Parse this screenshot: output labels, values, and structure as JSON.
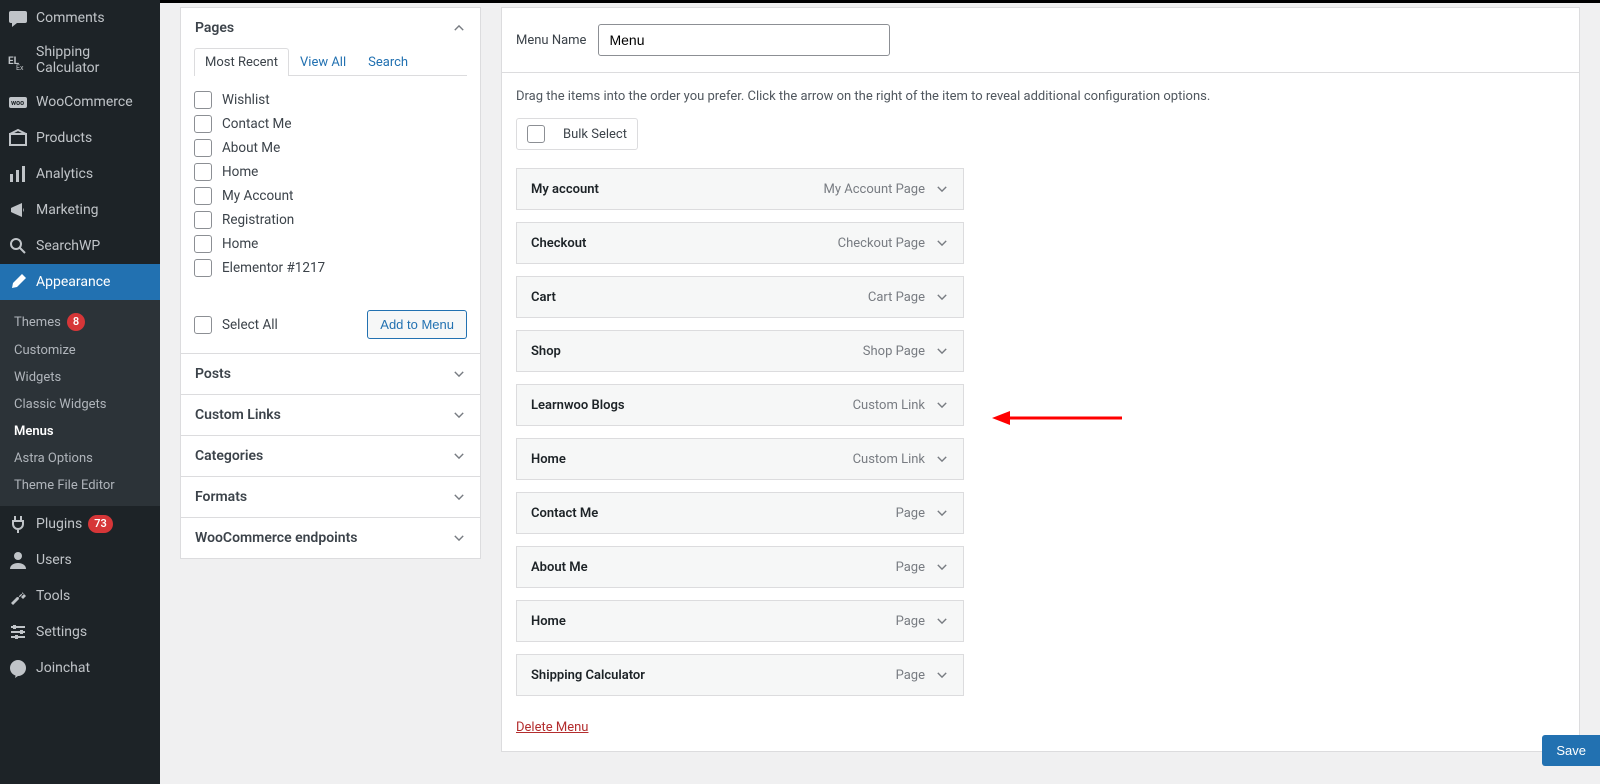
{
  "sidebar": {
    "items": [
      {
        "id": "comments",
        "label": "Comments",
        "icon": "comment"
      },
      {
        "id": "shipcalc",
        "label": "Shipping Calculator",
        "icon": "elex"
      },
      {
        "id": "woocommerce",
        "label": "WooCommerce",
        "icon": "woo"
      },
      {
        "id": "products",
        "label": "Products",
        "icon": "box"
      },
      {
        "id": "analytics",
        "label": "Analytics",
        "icon": "chart"
      },
      {
        "id": "marketing",
        "label": "Marketing",
        "icon": "megaphone"
      },
      {
        "id": "searchwp",
        "label": "SearchWP",
        "icon": "search"
      },
      {
        "id": "appearance",
        "label": "Appearance",
        "icon": "brush",
        "current": true
      },
      {
        "id": "plugins",
        "label": "Plugins",
        "icon": "plug",
        "badge": "73"
      },
      {
        "id": "users",
        "label": "Users",
        "icon": "user"
      },
      {
        "id": "tools",
        "label": "Tools",
        "icon": "wrench"
      },
      {
        "id": "settings",
        "label": "Settings",
        "icon": "sliders"
      },
      {
        "id": "joinchat",
        "label": "Joinchat",
        "icon": "chat"
      }
    ],
    "submenu": [
      {
        "label": "Themes",
        "badge": "8"
      },
      {
        "label": "Customize"
      },
      {
        "label": "Widgets"
      },
      {
        "label": "Classic Widgets"
      },
      {
        "label": "Menus",
        "current": true
      },
      {
        "label": "Astra Options"
      },
      {
        "label": "Theme File Editor"
      }
    ]
  },
  "pages_panel": {
    "title": "Pages",
    "tabs": [
      "Most Recent",
      "View All",
      "Search"
    ],
    "active_tab": 0,
    "items": [
      "Wishlist",
      "Contact Me",
      "About Me",
      "Home",
      "My Account",
      "Registration",
      "Home",
      "Elementor #1217"
    ],
    "select_all": "Select All",
    "add_button": "Add to Menu"
  },
  "other_panels": [
    "Posts",
    "Custom Links",
    "Categories",
    "Formats",
    "WooCommerce endpoints"
  ],
  "editor": {
    "name_label": "Menu Name",
    "name_value": "Menu",
    "help": "Drag the items into the order you prefer. Click the arrow on the right of the item to reveal additional configuration options.",
    "bulk_label": "Bulk Select",
    "items": [
      {
        "title": "My account",
        "type": "My Account Page"
      },
      {
        "title": "Checkout",
        "type": "Checkout Page"
      },
      {
        "title": "Cart",
        "type": "Cart Page"
      },
      {
        "title": "Shop",
        "type": "Shop Page"
      },
      {
        "title": "Learnwoo Blogs",
        "type": "Custom Link"
      },
      {
        "title": "Home",
        "type": "Custom Link"
      },
      {
        "title": "Contact Me",
        "type": "Page"
      },
      {
        "title": "About Me",
        "type": "Page"
      },
      {
        "title": "Home",
        "type": "Page"
      },
      {
        "title": "Shipping Calculator",
        "type": "Page"
      }
    ],
    "delete": "Delete Menu",
    "save": "Save"
  }
}
